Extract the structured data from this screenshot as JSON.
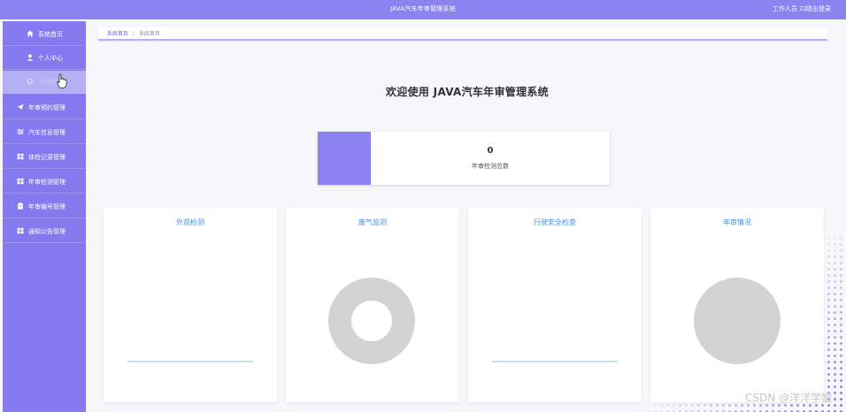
{
  "header": {
    "title": "JAVA汽车年审管理系统",
    "user": "工作人员 22",
    "logout": "退出登录"
  },
  "sidebar": {
    "items": [
      {
        "label": "系统首页",
        "icon": "home-icon"
      },
      {
        "label": "个人中心",
        "icon": "person-icon"
      },
      {
        "label": "系统管理",
        "icon": "settings-icon"
      },
      {
        "label": "年审预约管理",
        "icon": "send-icon"
      },
      {
        "label": "汽车信息管理",
        "icon": "sliders-icon"
      },
      {
        "label": "体检记录管理",
        "icon": "grid-icon"
      },
      {
        "label": "年审检测管理",
        "icon": "grid-icon"
      },
      {
        "label": "年审编号管理",
        "icon": "clipboard-icon"
      },
      {
        "label": "通知公告管理",
        "icon": "grid-icon"
      }
    ]
  },
  "breadcrumb": {
    "home": "系统首页",
    "separator": "/",
    "current": "系统首页"
  },
  "welcome": "欢迎使用 JAVA汽车年审管理系统",
  "stat": {
    "value": "0",
    "label": "年审检测总数"
  },
  "panels": [
    {
      "title": "外观检测"
    },
    {
      "title": "废气监测"
    },
    {
      "title": "行驶安全检查"
    },
    {
      "title": "年审情况"
    }
  ],
  "watermark": "CSDN @洋洋学姐",
  "colors": {
    "accent": "#8479ee",
    "header": "#8b83f0",
    "panel_title": "#4a8fd8",
    "chart_placeholder": "#d3d3d3",
    "axis_line": "#7fc4c8"
  }
}
